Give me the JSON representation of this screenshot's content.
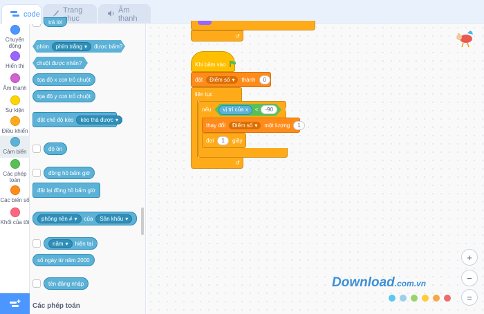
{
  "tabs": [
    {
      "label": "code",
      "icon": "code-icon"
    },
    {
      "label": "Trang phục",
      "icon": "brush-icon"
    },
    {
      "label": "Âm thanh",
      "icon": "speaker-icon"
    }
  ],
  "categories": [
    {
      "label": "Chuyển động",
      "color": "#4c97ff"
    },
    {
      "label": "Hiển thị",
      "color": "#9966ff"
    },
    {
      "label": "Âm thanh",
      "color": "#cf63cf"
    },
    {
      "label": "Sự kiện",
      "color": "#ffd500"
    },
    {
      "label": "Điều khiển",
      "color": "#ffab19"
    },
    {
      "label": "Cảm biến",
      "color": "#5cb1d6"
    },
    {
      "label": "Các phép toán",
      "color": "#59c059"
    },
    {
      "label": "Các biến số",
      "color": "#ff8c1a"
    },
    {
      "label": "Khối của tôi",
      "color": "#ff6680"
    }
  ],
  "palette": {
    "tra_loi": "trả lời",
    "phim": "phím",
    "phim_trang": "phím trắng",
    "duoc_bam": "được bấm?",
    "chuot_nhan": "chuột được nhấn?",
    "toa_do_x": "tọa độ x con trỏ chuột",
    "toa_do_y": "tọa độ y con trỏ chuột",
    "dat_che_do_keo": "đặt chế độ kéo",
    "keo_tha_duoc": "kéo thả được",
    "do_on": "độ ồn",
    "dong_ho": "đồng hồ bấm giờ",
    "dat_lai_dong_ho": "đặt lại đồng hồ bấm giờ",
    "phong_nen": "phông nền #",
    "cua": "của",
    "san_khau": "Sân khấu",
    "nam": "năm",
    "hien_tai": "hiện tại",
    "so_ngay": "số ngày từ năm 2000",
    "ten_dang_nhap": "tên đăng nhập",
    "section_title": "Các phép toán"
  },
  "script": {
    "khi_bam_vao": "Khi bấm vào",
    "dat": "đặt",
    "diem_so": "Điểm số",
    "thanh": "thành",
    "init_value": "0",
    "lien_tuc": "liên tục",
    "neu": "nếu",
    "vi_tri_cua_x": "vị trí của x",
    "lt_sign": "<",
    "threshold": "-90",
    "thi": "thì",
    "thay_doi": "thay đổi",
    "mot_luong": "một lượng",
    "change_value": "1",
    "doi": "đợi",
    "wait_value": "1",
    "giay": "giây"
  },
  "zoom": {
    "in": "+",
    "out": "−",
    "reset": "="
  },
  "watermark": {
    "main": "Download",
    "suffix": ".com.vn",
    "dots": [
      "#5cc8f0",
      "#9ad0e8",
      "#9bd36a",
      "#ffcc33",
      "#f7a64a",
      "#ef6b6b"
    ]
  }
}
